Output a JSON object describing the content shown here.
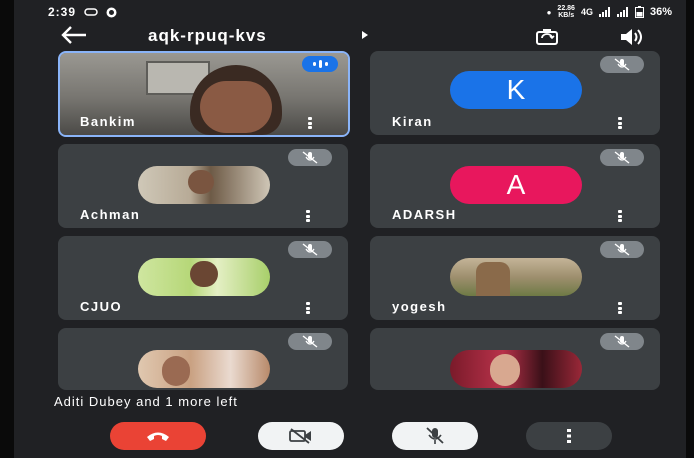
{
  "status_bar": {
    "time": "2:39",
    "net_speed_value": "22.86",
    "net_speed_unit": "KB/s",
    "network": "4G",
    "battery": "36%"
  },
  "header": {
    "meeting_code": "aqk-rpuq-kvs"
  },
  "participants": [
    {
      "name": "Bankim",
      "type": "video",
      "speaking": true
    },
    {
      "name": "Kiran",
      "type": "letter",
      "letter": "K",
      "color": "#1a73e8",
      "muted": true
    },
    {
      "name": "Achman",
      "type": "photo",
      "muted": true
    },
    {
      "name": "ADARSH",
      "type": "letter",
      "letter": "A",
      "color": "#e8175d",
      "muted": true
    },
    {
      "name": "CJUO",
      "type": "photo",
      "muted": true
    },
    {
      "name": "yogesh",
      "type": "photo",
      "muted": true
    },
    {
      "name": "",
      "type": "photo",
      "muted": true
    },
    {
      "name": "",
      "type": "photo",
      "muted": true
    }
  ],
  "left_message": "Aditi Dubey and 1 more left",
  "colors": {
    "background": "#202124",
    "tile": "#3c4043",
    "end_call": "#ea4335",
    "accent": "#8ab4f8"
  },
  "icons": [
    "back-arrow-icon",
    "switch-camera-icon",
    "speaker-icon",
    "mic-off-icon",
    "more-vert-icon",
    "end-call-icon",
    "camera-off-icon"
  ]
}
